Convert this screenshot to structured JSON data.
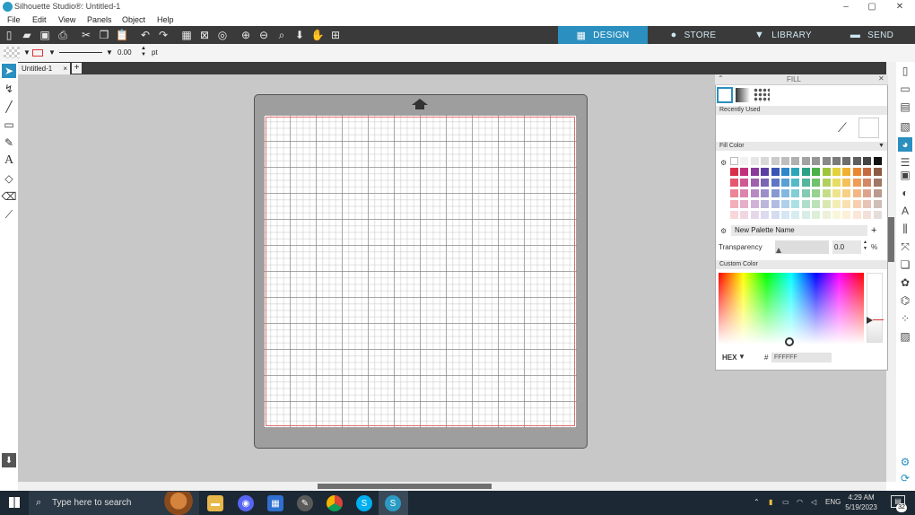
{
  "window": {
    "title": "Silhouette Studio®: Untitled-1",
    "controls": [
      "–",
      "▢",
      "✕"
    ]
  },
  "menu": [
    "File",
    "Edit",
    "View",
    "Panels",
    "Object",
    "Help"
  ],
  "main_tabs": [
    {
      "label": "DESIGN",
      "icon": "grid-icon",
      "active": true
    },
    {
      "label": "STORE",
      "icon": "silhouette-s-icon",
      "active": false
    },
    {
      "label": "LIBRARY",
      "icon": "library-download-icon",
      "active": false
    },
    {
      "label": "SEND",
      "icon": "send-icon",
      "active": false
    }
  ],
  "property_bar": {
    "line_width": "0.00",
    "unit": "pt"
  },
  "document_tab": {
    "name": "Untitled-1",
    "close": "×",
    "add": "+"
  },
  "fill_panel": {
    "title": "FILL",
    "recently_used_label": "Recently Used",
    "fill_color_label": "Fill Color",
    "new_palette_name": "New Palette Name",
    "add_palette": "+",
    "transparency_label": "Transparency",
    "transparency_value": "0.0",
    "transparency_unit": "%",
    "custom_color_label": "Custom Color",
    "hex_label": "HEX",
    "hash": "#",
    "hex_value": "FFFFFF",
    "palette_rows": [
      [
        "#ffffff",
        "#f2f2f2",
        "#e6e6e6",
        "#d8d8d8",
        "#cbcbcb",
        "#bebebe",
        "#b0b0b0",
        "#a3a3a3",
        "#959595",
        "#888888",
        "#7a7a7a",
        "#6d6d6d",
        "#5f5f5f",
        "#444444",
        "#111111"
      ],
      [
        "#d9304b",
        "#c2307a",
        "#8a3a9a",
        "#5a3fa0",
        "#3c55b4",
        "#2f86c9",
        "#2aa6b8",
        "#2ba186",
        "#4cb04a",
        "#9fc43a",
        "#e3d23c",
        "#f0b030",
        "#eb8630",
        "#c86a40",
        "#8a5a44"
      ],
      [
        "#e5586f",
        "#cf5893",
        "#a060ae",
        "#7a64b4",
        "#5e76c4",
        "#57a0d6",
        "#55bac8",
        "#55b69c",
        "#70c26c",
        "#b2d05e",
        "#e9dc62",
        "#f3c05a",
        "#f09c58",
        "#d28766",
        "#a07866"
      ],
      [
        "#ec8496",
        "#da84ae",
        "#b88ac2",
        "#9c8ec8",
        "#8698d2",
        "#82b8e0",
        "#82cdd6",
        "#84cbb4",
        "#96d292",
        "#c6dd88",
        "#efe48e",
        "#f6d088",
        "#f4b686",
        "#dca48e",
        "#b89a8e"
      ],
      [
        "#f3aeba",
        "#e6aec8",
        "#d0b2d6",
        "#bcb6da",
        "#b0bce2",
        "#aed0ea",
        "#ade0e4",
        "#b0ddcc",
        "#bce2b8",
        "#d9e8b2",
        "#f4edb6",
        "#f9e0b2",
        "#f8ceb0",
        "#e6c4b6",
        "#d0bfb6"
      ],
      [
        "#f8d6dc",
        "#f0d6e2",
        "#e6d8ea",
        "#dcdaee",
        "#d6dcf0",
        "#d6e6f4",
        "#d6eef0",
        "#d8eee4",
        "#dcf0d8",
        "#ecf2d8",
        "#faf6da",
        "#fcf0d8",
        "#fce6d8",
        "#f2e0da",
        "#e6ddda"
      ]
    ]
  },
  "taskbar": {
    "search_placeholder": "Type here to search",
    "language": "ENG",
    "time": "4:29 AM",
    "date": "5/19/2023",
    "notifications": "32"
  }
}
